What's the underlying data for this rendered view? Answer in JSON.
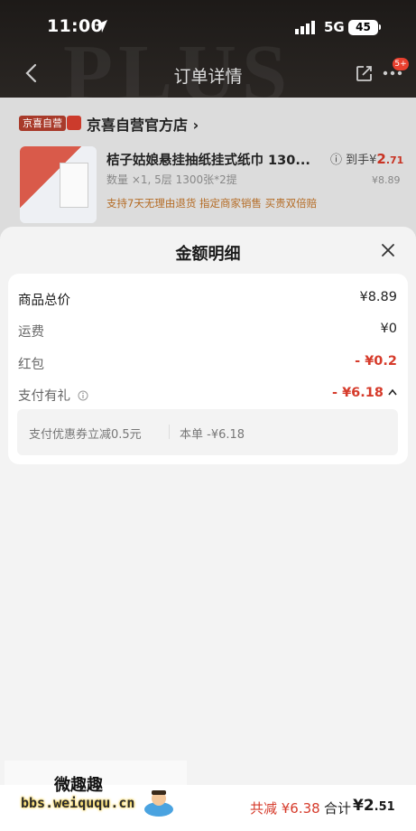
{
  "status_bar": {
    "time": "11:00",
    "network": "5G",
    "battery": "45"
  },
  "header": {
    "title": "订单详情",
    "badge": "5+",
    "watermark": "PLUS"
  },
  "store": {
    "tag": "京喜自营",
    "name": "京喜自营官方店 ›",
    "product": {
      "title": "桔子姑娘悬挂抽纸挂式纸巾 130...",
      "spec": "数量 ×1, 5层 1300张*2提",
      "tags": "支持7天无理由退货   指定商家销售   买贵双倍赔",
      "price_prefix": "ⓘ 到手¥",
      "price_int": "2",
      "price_dec": ".71",
      "original_price": "¥8.89"
    }
  },
  "sheet": {
    "title": "金额明细",
    "rows": [
      {
        "label": "商品总价",
        "value": "¥8.89"
      },
      {
        "label": "运费",
        "value": "¥0"
      },
      {
        "label": "红包",
        "value": "- ¥0.2"
      },
      {
        "label": "支付有礼",
        "value": "- ¥6.18"
      }
    ],
    "coupon": {
      "text": "支付优惠券立减0.5元",
      "bill": "本单 -¥6.18"
    }
  },
  "bottom": {
    "reduce": "共减 ¥6.38",
    "total_label": "合计",
    "total_int": "¥2",
    "total_dec": ".51"
  },
  "watermark": {
    "cn": "微趣趣",
    "url": "bbs.weiququ.cn"
  },
  "colors": {
    "accent_red": "#d63b2b",
    "tag_brown": "#b46b24",
    "sheet_bg": "#f3f3f3"
  }
}
